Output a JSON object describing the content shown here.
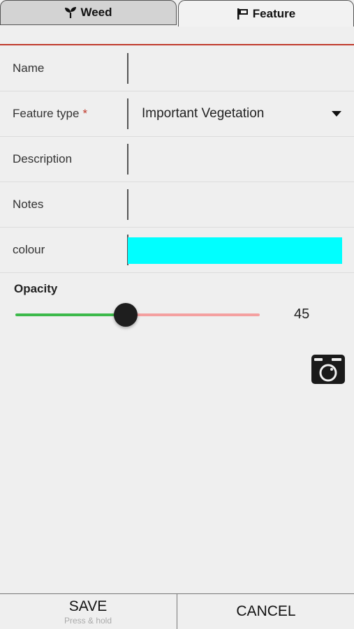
{
  "tabs": [
    {
      "label": "Weed",
      "icon": "sprout-icon",
      "active": false
    },
    {
      "label": "Feature",
      "icon": "flag-icon",
      "active": true
    }
  ],
  "form": {
    "name": {
      "label": "Name",
      "value": ""
    },
    "feature_type": {
      "label": "Feature type",
      "required_mark": "*",
      "value": "Important Vegetation"
    },
    "description": {
      "label": "Description",
      "value": ""
    },
    "notes": {
      "label": "Notes",
      "value": ""
    },
    "colour": {
      "label": "colour",
      "value": "#00FFFF"
    }
  },
  "opacity": {
    "label": "Opacity",
    "value": 45,
    "min": 0,
    "max": 100,
    "fill_color": "#3cb94a",
    "track_color": "#f4a0a0"
  },
  "camera": {
    "icon": "camera-icon"
  },
  "footer": {
    "save_label": "SAVE",
    "save_hint": "Press & hold",
    "cancel_label": "CANCEL"
  },
  "colors": {
    "accent_line": "#c0392b"
  }
}
